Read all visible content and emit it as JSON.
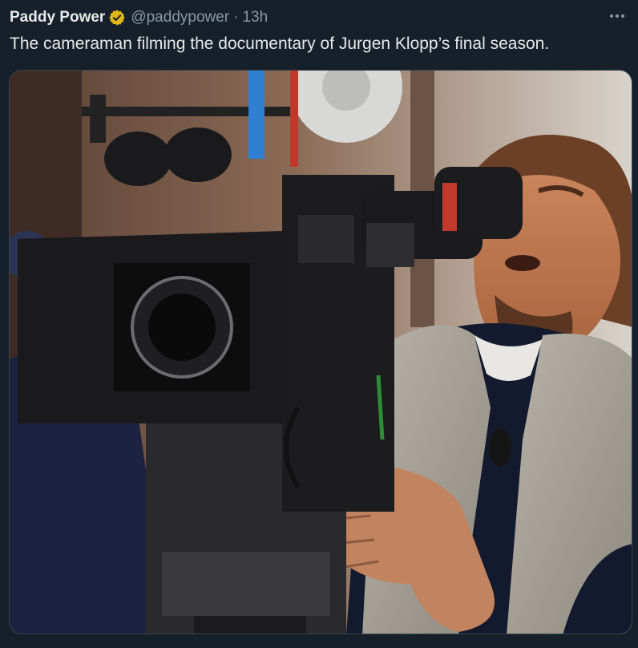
{
  "author": {
    "display_name": "Paddy Power",
    "verified_badge_icon": "verified-gold-badge-icon",
    "handle": "@paddypower",
    "separator": "·",
    "timestamp": "13h"
  },
  "menu": {
    "more_icon": "more-options-icon"
  },
  "tweet": {
    "text": "The cameraman filming the documentary of Jurgen Klopp’s final season."
  },
  "media": {
    "kind": "photo",
    "subject": "man-looking-through-film-camera-eyepiece"
  },
  "colors": {
    "background": "#15202b",
    "primary_text": "#e7e9ea",
    "secondary_text": "#8b98a5",
    "verified_gold": "#e2b719",
    "border": "#38444d"
  }
}
